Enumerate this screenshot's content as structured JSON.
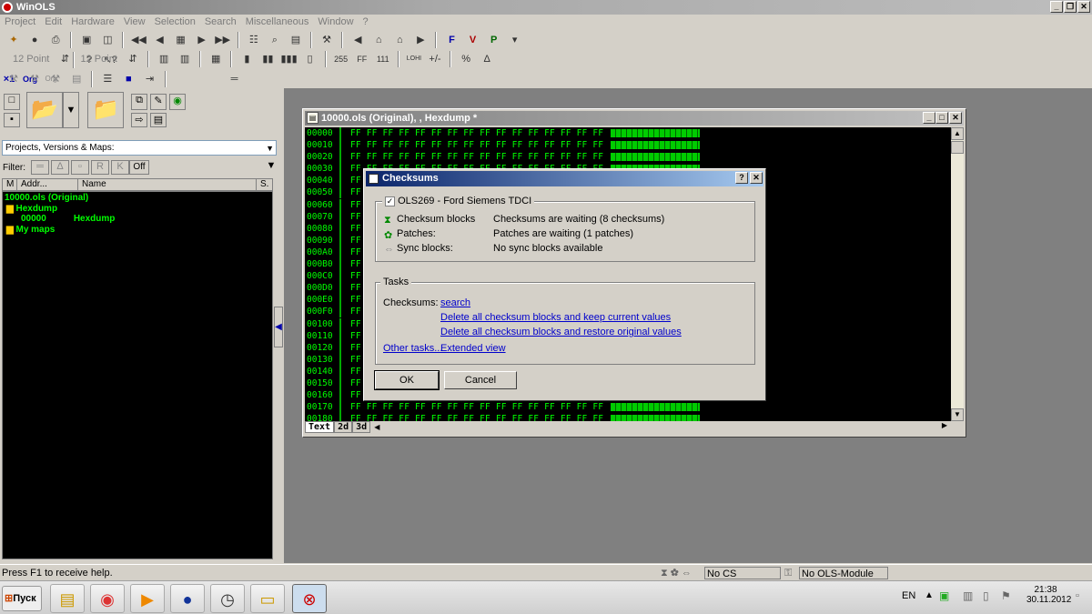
{
  "app": {
    "title": "WinOLS"
  },
  "menu": [
    "Project",
    "Edit",
    "Hardware",
    "View",
    "Selection",
    "Search",
    "Miscellaneous",
    "Window",
    "?"
  ],
  "toolbar": {
    "font_size_1": "12 Point",
    "font_size_2": "12 Point",
    "ff_label": "FF",
    "x1_label": "×1",
    "org_label": "Org",
    "pct_label": "%",
    "delta_label": "Δ"
  },
  "left": {
    "combo": "Projects, Versions & Maps:",
    "filter_label": "Filter:",
    "filter_off": "Off",
    "columns": [
      "M",
      "Addr...",
      "Name",
      "S."
    ],
    "tree": [
      {
        "text": "10000.ols (Original)"
      },
      {
        "text": "Hexdump",
        "folder": true
      },
      {
        "text": "00000",
        "name": "Hexdump"
      },
      {
        "text": "My maps",
        "folder": true
      }
    ]
  },
  "hexwin": {
    "title": "10000.ols (Original), , Hexdump *",
    "byte": "FF",
    "addresses": [
      "00000",
      "00010",
      "00020",
      "00030",
      "00040",
      "00050",
      "00060",
      "00070",
      "00080",
      "00090",
      "000A0",
      "000B0",
      "000C0",
      "000D0",
      "000E0",
      "000F0",
      "00100",
      "00110",
      "00120",
      "00130",
      "00140",
      "00150",
      "00160",
      "00170",
      "00180"
    ],
    "tabs": [
      "Text",
      "2d",
      "3d"
    ]
  },
  "dialog": {
    "title": "Checksums",
    "help": "?",
    "close": "✕",
    "module": "OLS269 - Ford Siemens TDCI",
    "rows": [
      {
        "label": "Checksum blocks",
        "value": "Checksums are waiting (8 checksums)"
      },
      {
        "label": "Patches:",
        "value": "Patches are waiting (1 patches)"
      },
      {
        "label": "Sync blocks:",
        "value": "No sync blocks available"
      }
    ],
    "tasks_title": "Tasks",
    "checksums_label": "Checksums:",
    "link_search": "search",
    "link_delete_keep": "Delete all checksum blocks and keep current values",
    "link_delete_restore": "Delete all checksum blocks and restore original values",
    "link_other": "Other tasks...",
    "link_extended": "Extended view",
    "ok": "OK",
    "cancel": "Cancel"
  },
  "status": {
    "help": "Press F1 to receive help.",
    "cs": "No CS",
    "module": "No OLS-Module"
  },
  "taskbar": {
    "start": "Пуск",
    "lang": "EN",
    "time": "21:38",
    "date": "30.11.2012"
  }
}
